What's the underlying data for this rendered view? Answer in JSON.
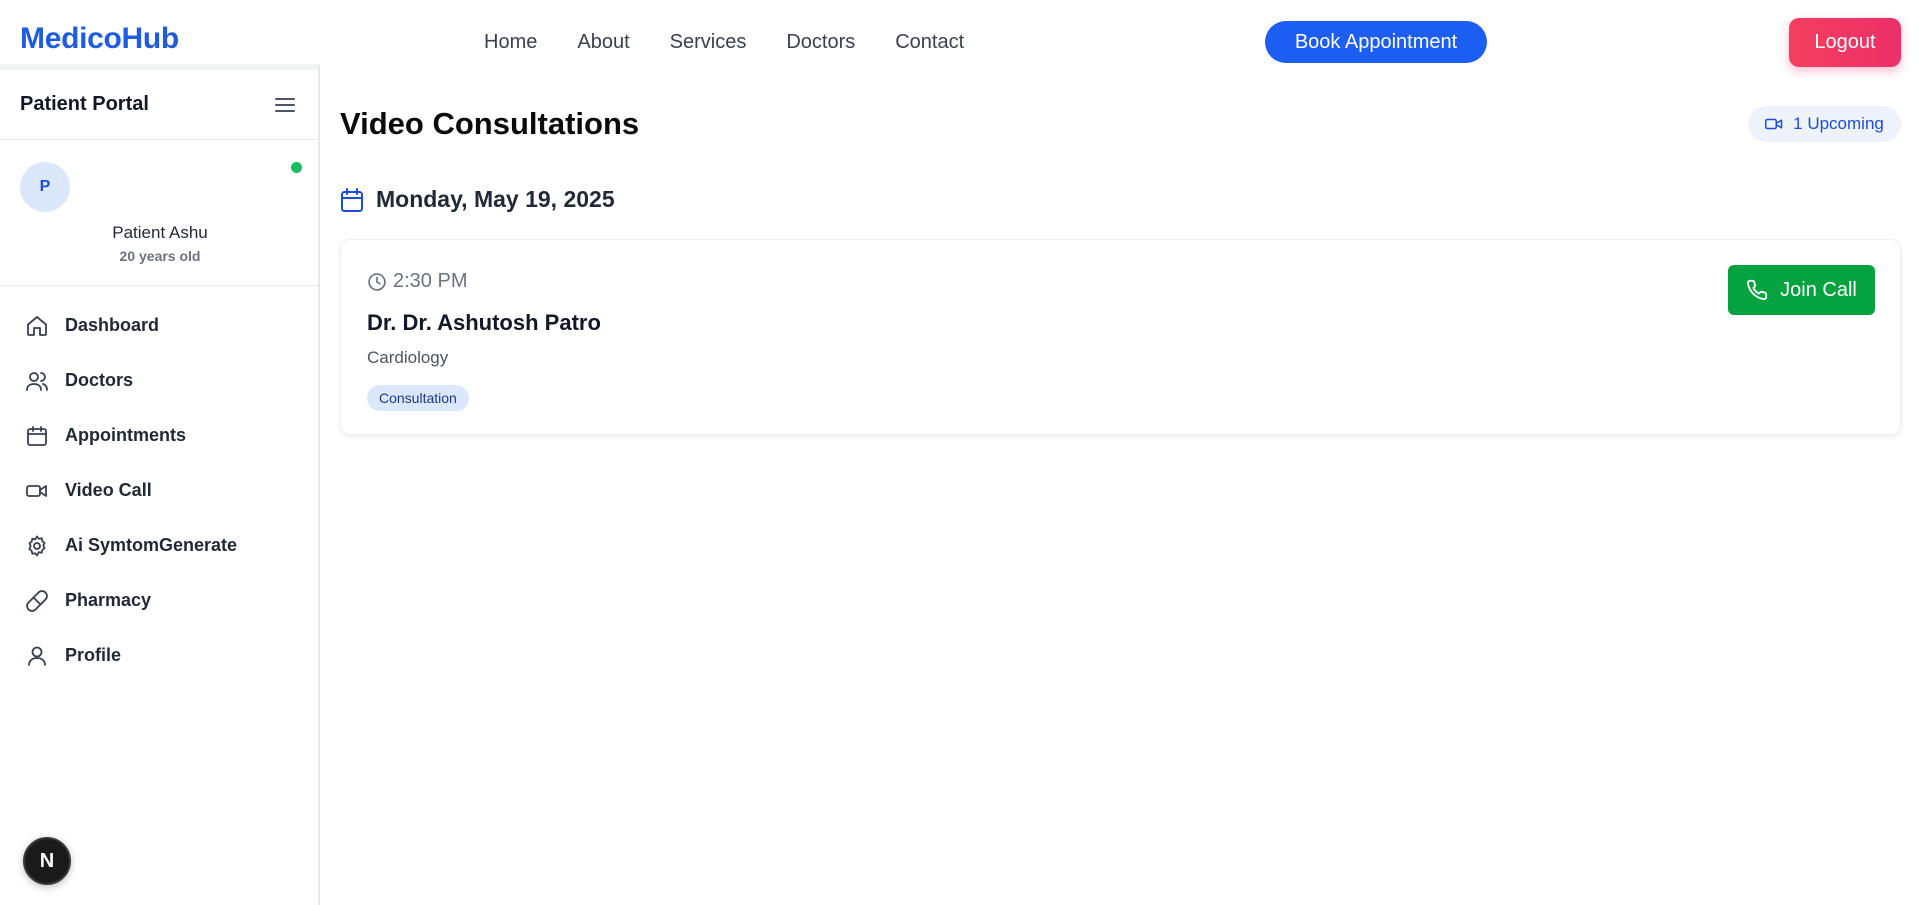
{
  "header": {
    "brand": "MedicoHub",
    "nav": [
      "Home",
      "About",
      "Services",
      "Doctors",
      "Contact"
    ],
    "book_label": "Book Appointment",
    "logout_label": "Logout"
  },
  "sidebar": {
    "title": "Patient Portal",
    "profile": {
      "initial": "P",
      "name": "Patient Ashu",
      "age": "20 years old",
      "online": true
    },
    "items": [
      {
        "label": "Dashboard",
        "icon": "home-icon"
      },
      {
        "label": "Doctors",
        "icon": "users-icon"
      },
      {
        "label": "Appointments",
        "icon": "calendar-icon"
      },
      {
        "label": "Video Call",
        "icon": "video-icon"
      },
      {
        "label": "Ai SymtomGenerate",
        "icon": "gear-icon"
      },
      {
        "label": "Pharmacy",
        "icon": "pill-icon"
      },
      {
        "label": "Profile",
        "icon": "user-icon"
      }
    ],
    "dev_badge": "N"
  },
  "main": {
    "title": "Video Consultations",
    "upcoming_badge": "1 Upcoming",
    "date": "Monday, May 19, 2025",
    "appointment": {
      "time": "2:30 PM",
      "doctor": "Dr. Dr. Ashutosh Patro",
      "specialty": "Cardiology",
      "tag": "Consultation",
      "join_label": "Join Call"
    }
  },
  "colors": {
    "brand": "#1f5de0",
    "primary_button": "#1c5df2",
    "logout_start": "#f43f5e",
    "logout_end": "#ec2f6a",
    "join_button": "#05a33f",
    "online": "#16c060"
  }
}
